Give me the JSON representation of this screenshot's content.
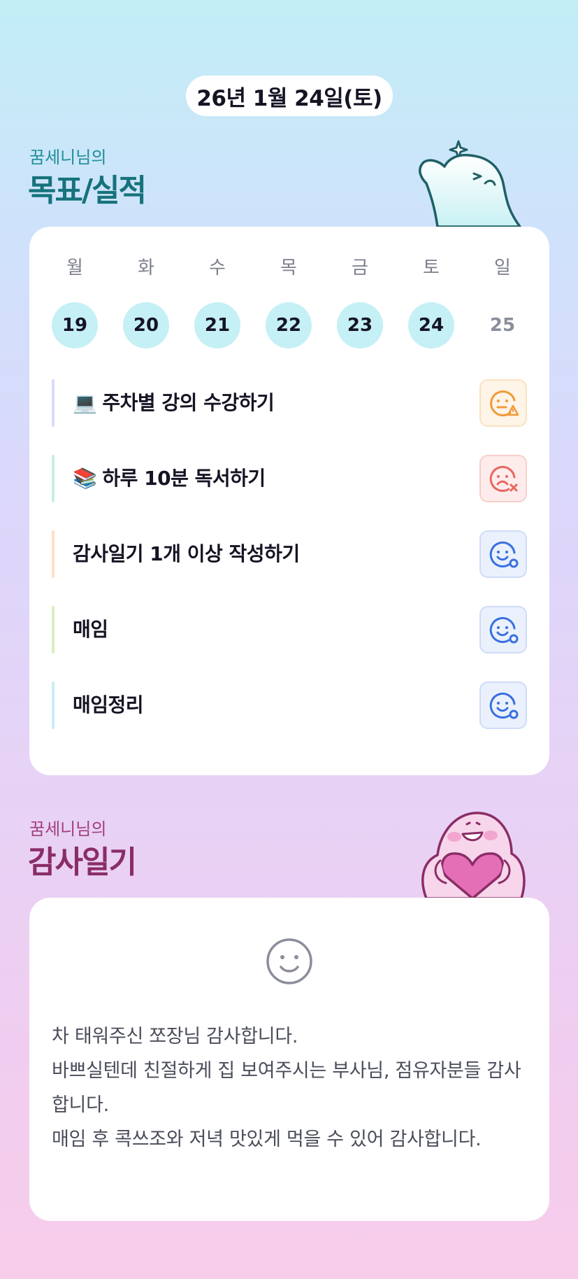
{
  "date_label": "26년 1월 24일(토)",
  "goals_section": {
    "subtitle": "꿈세니님의",
    "title": "목표/실적"
  },
  "week": [
    {
      "day": "월",
      "date": "19",
      "active": true
    },
    {
      "day": "화",
      "date": "20",
      "active": true
    },
    {
      "day": "수",
      "date": "21",
      "active": true
    },
    {
      "day": "목",
      "date": "22",
      "active": true
    },
    {
      "day": "금",
      "date": "23",
      "active": true
    },
    {
      "day": "토",
      "date": "24",
      "active": true
    },
    {
      "day": "일",
      "date": "25",
      "active": false
    }
  ],
  "goals": [
    {
      "icon": "💻",
      "label": "주차별 강의 수강하기",
      "bar_color": "#d9dcfb",
      "status": "warning",
      "status_icon": "face-warning-icon"
    },
    {
      "icon": "📚",
      "label": "하루 10분 독서하기",
      "bar_color": "#c6f0dc",
      "status": "failed",
      "status_icon": "face-failed-icon"
    },
    {
      "icon": "",
      "label": "감사일기 1개 이상 작성하기",
      "bar_color": "#fde0c4",
      "status": "done",
      "status_icon": "face-done-icon"
    },
    {
      "icon": "",
      "label": "매임",
      "bar_color": "#d7f0b8",
      "status": "done",
      "status_icon": "face-done-icon"
    },
    {
      "icon": "",
      "label": "매임정리",
      "bar_color": "#c6eef4",
      "status": "done",
      "status_icon": "face-done-icon"
    }
  ],
  "diary_section": {
    "subtitle": "꿈세니님의",
    "title": "감사일기"
  },
  "diary": {
    "mood_icon": "smile-face-icon",
    "lines": [
      "차 태워주신 쪼장님 감사합니다.",
      "바쁘실텐데 친절하게 집 보여주시는 부사님, 점유자분들 감사합니다.",
      "매임 후 콕쓰조와 저녁 맛있게 먹을 수 있어 감사합니다."
    ]
  },
  "colors": {
    "status_warning": "#f29a3a",
    "status_failed": "#e8675f",
    "status_done": "#3a6fe0",
    "teal": "#1f8e97",
    "plum": "#a23f79"
  }
}
